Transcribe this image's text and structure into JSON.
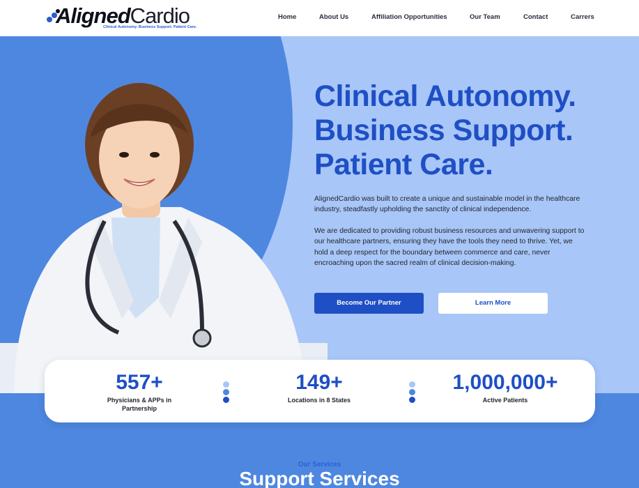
{
  "brand": {
    "name_bold": "Aligned",
    "name_light": "Cardio",
    "tagline": "Clinical Autonomy. Business Support. Patient Care.",
    "color_primary": "#1e4fc5",
    "color_light": "#a8c6f7",
    "color_mid": "#4e87e0"
  },
  "nav": {
    "items": [
      {
        "label": "Home"
      },
      {
        "label": "About Us"
      },
      {
        "label": "Affiliation Opportunities"
      },
      {
        "label": "Our Team"
      },
      {
        "label": "Contact"
      },
      {
        "label": "Carrers"
      }
    ]
  },
  "hero": {
    "headline": [
      "Clinical Autonomy.",
      "Business Support.",
      "Patient Care."
    ],
    "paragraphs": [
      "AlignedCardio was built to create a unique and sustainable model in the healthcare industry, steadfastly upholding the sanctity of clinical independence.",
      "We are dedicated to providing robust business resources and unwavering support to our healthcare partners, ensuring they have the tools they need to thrive. Yet, we hold a deep respect for the boundary between commerce and care, never encroaching upon the sacred realm of clinical decision-making."
    ],
    "primary_button": "Become Our Partner",
    "secondary_button": "Learn More"
  },
  "stats": [
    {
      "value": "557+",
      "label": "Physicians & APPs in Partnership"
    },
    {
      "value": "149+",
      "label": "Locations in 8 States"
    },
    {
      "value": "1,000,000+",
      "label": "Active Patients"
    }
  ],
  "services": {
    "kicker": "Our Services",
    "title": "Support Services"
  }
}
